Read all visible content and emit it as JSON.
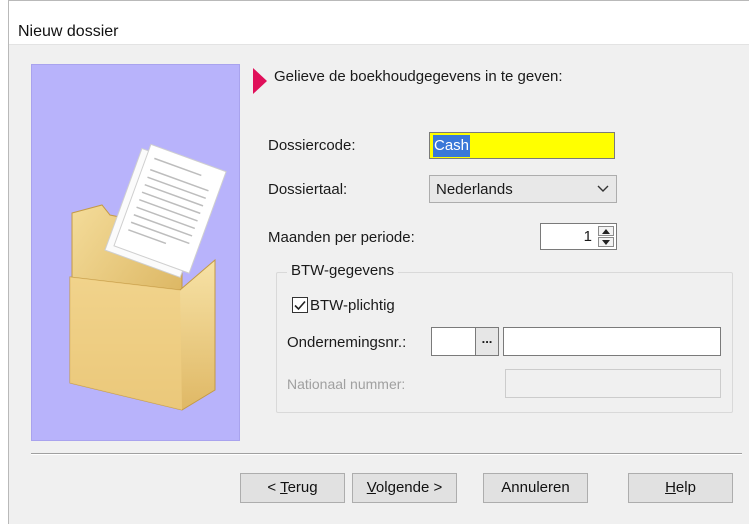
{
  "window": {
    "title": "Nieuw dossier"
  },
  "main": {
    "heading": "Gelieve de boekhoudgegevens in te geven:",
    "dossiercode": {
      "label": "Dossiercode:",
      "value": "Cash"
    },
    "dossiertaal": {
      "label": "Dossiertaal:",
      "value": "Nederlands"
    },
    "maanden": {
      "label": "Maanden per periode:",
      "value": "1"
    }
  },
  "btw": {
    "group_title": "BTW-gegevens",
    "plichtig": {
      "label": "BTW-plichtig",
      "checked": true
    },
    "ondernemingsnr": {
      "label": "Ondernemingsnr.:",
      "button_label": "..."
    },
    "nationaal": {
      "label": "Nationaal nummer:"
    }
  },
  "buttons": {
    "back": {
      "prefix": "< ",
      "mnemonic": "T",
      "rest": "erug"
    },
    "next": {
      "mnemonic": "V",
      "rest": "olgende >"
    },
    "cancel": {
      "label": "Annuleren"
    },
    "help": {
      "mnemonic": "H",
      "rest": "elp"
    }
  },
  "colors": {
    "side_panel": "#b8b3fb",
    "pointer": "#e0105a",
    "required_field": "#ffff00",
    "selection": "#3a78d8"
  },
  "icons": [
    "folder-documents-icon",
    "pointer-arrow-icon",
    "chevron-down-icon",
    "spin-up-icon",
    "spin-down-icon",
    "checkmark-icon"
  ]
}
